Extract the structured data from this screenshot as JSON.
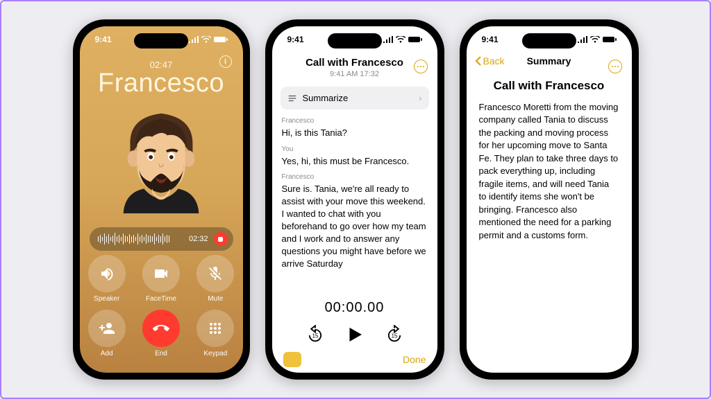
{
  "status": {
    "time": "9:41"
  },
  "call": {
    "name": "Francesco",
    "elapsed": "02:47",
    "rec_time": "02:32",
    "controls": [
      {
        "key": "speaker",
        "label": "Speaker"
      },
      {
        "key": "facetime",
        "label": "FaceTime"
      },
      {
        "key": "mute",
        "label": "Mute"
      },
      {
        "key": "add",
        "label": "Add"
      },
      {
        "key": "end",
        "label": "End"
      },
      {
        "key": "keypad",
        "label": "Keypad"
      }
    ]
  },
  "transcript": {
    "title": "Call with Francesco",
    "subtitle": "9:41 AM  17:32",
    "summarize_label": "Summarize",
    "player_time": "00:00.00",
    "done_label": "Done",
    "turns": [
      {
        "speaker": "Francesco",
        "text": "Hi, is this Tania?"
      },
      {
        "speaker": "You",
        "text": "Yes, hi, this must be Francesco."
      },
      {
        "speaker": "Francesco",
        "text": "Sure is. Tania, we're all ready to assist with your move this weekend. I wanted to chat with you beforehand to go over how my team and I work and to answer any questions you might have before we arrive Saturday"
      }
    ]
  },
  "summary": {
    "back_label": "Back",
    "nav_title": "Summary",
    "title": "Call with Francesco",
    "body": "Francesco Moretti from the moving company called Tania to discuss the packing and moving process for her upcoming move to Santa Fe. They plan to take three days to pack everything up, including fragile items, and will need Tania to identify items she won't be bringing. Francesco also mentioned the need for a parking permit and a customs form."
  }
}
